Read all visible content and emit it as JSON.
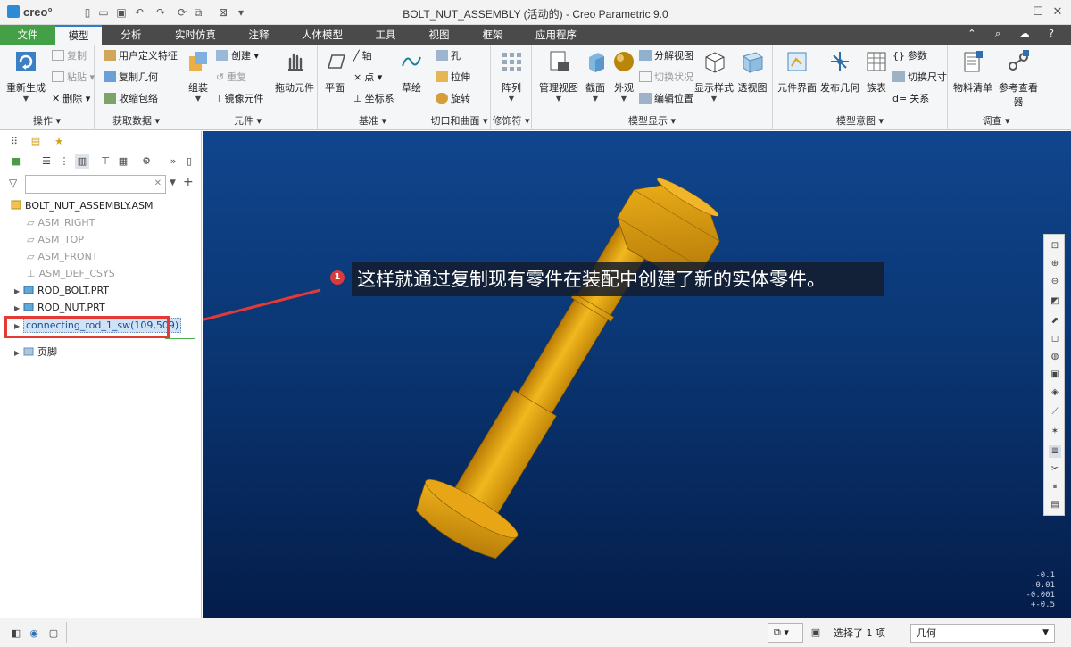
{
  "app": {
    "logo": "creo°",
    "title": "BOLT_NUT_ASSEMBLY (活动的) - Creo Parametric 9.0"
  },
  "tabs": [
    "文件",
    "模型",
    "分析",
    "实时仿真",
    "注释",
    "人体模型",
    "工具",
    "视图",
    "框架",
    "应用程序"
  ],
  "ribbon": {
    "operations": {
      "label": "操作",
      "regenerate": "重新生成",
      "copy": "复制",
      "paste": "粘贴",
      "delete": "删除"
    },
    "get_data": {
      "label": "获取数据",
      "udf": "用户定义特征",
      "copy_geom": "复制几何",
      "shrinkwrap": "收缩包络"
    },
    "component": {
      "label": "元件",
      "assemble": "组装",
      "create": "创建",
      "repeat": "重复",
      "mirror": "镜像元件",
      "drag": "拖动元件"
    },
    "datum": {
      "label": "基准",
      "plane": "平面",
      "axis": "轴",
      "point": "点",
      "csys": "坐标系",
      "sketch": "草绘"
    },
    "cut_surface": {
      "label": "切口和曲面",
      "hole": "孔",
      "extrude": "拉伸",
      "revolve": "旋转"
    },
    "modifiers": {
      "label": "修饰符",
      "pattern": "阵列"
    },
    "model_display": {
      "label": "模型显示",
      "manage_views": "管理视图",
      "section": "截面",
      "appearance": "外观",
      "explode": "分解视图",
      "toggle_status": "切换状况",
      "edit_position": "编辑位置",
      "display_style": "显示样式",
      "perspective": "透视图"
    },
    "model_intent": {
      "label": "模型意图",
      "component_interface": "元件界面",
      "publish_geom": "发布几何",
      "family_table": "族表",
      "parameters": "参数",
      "switch_dims": "切换尺寸",
      "relations": "关系"
    },
    "investigate": {
      "label": "调查",
      "bom": "物料清单",
      "ref_viewer": "参考查看器"
    }
  },
  "tree": {
    "root": "BOLT_NUT_ASSEMBLY.ASM",
    "items": [
      "ASM_RIGHT",
      "ASM_TOP",
      "ASM_FRONT",
      "ASM_DEF_CSYS",
      "ROD_BOLT.PRT",
      "ROD_NUT.PRT",
      "connecting_rod_1_sw(109,509)",
      "页脚"
    ]
  },
  "callout": {
    "badge": "1",
    "text": "这样就通过复制现有零件在装配中创建了新的实体零件。"
  },
  "viewport": {
    "tolerances": [
      "-0.1",
      "-0.01",
      "-0.001",
      "+-0.5"
    ]
  },
  "status": {
    "selected": "选择了 1 项",
    "filter_value": "几何"
  },
  "colors": {
    "file_tab": "#43a047",
    "highlight_box": "#e53935",
    "part_gold": "#e8a417",
    "viewport_bg": "#0a3673"
  }
}
